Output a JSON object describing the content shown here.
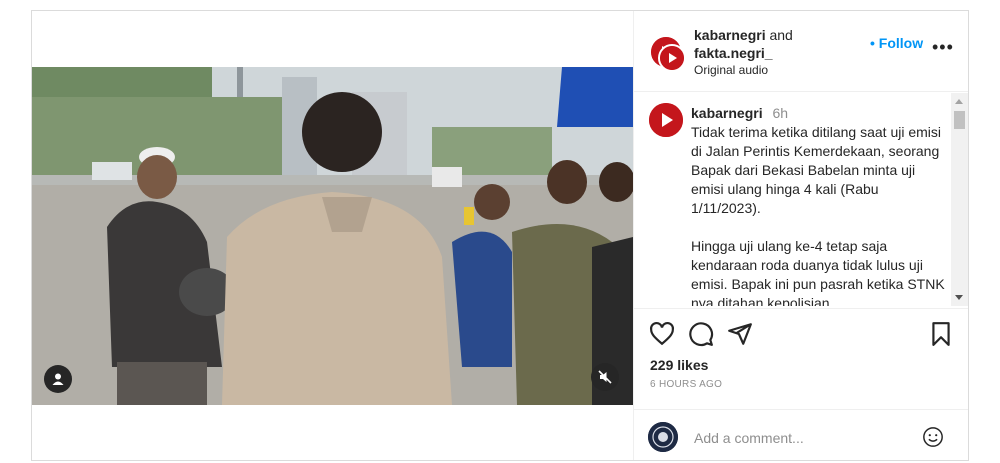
{
  "header": {
    "user1": "kabarnegri",
    "and_text": "and",
    "user2": "fakta.negri_",
    "audio": "Original audio",
    "follow_label": "Follow",
    "more_label": "•••"
  },
  "caption": {
    "username": "kabarnegri",
    "time": "6h",
    "paragraph1": "Tidak terima ketika ditilang saat uji emisi di Jalan Perintis Kemerdekaan, seorang Bapak dari Bekasi Babelan minta uji emisi ulang hinga 4 kali (Rabu 1/11/2023).",
    "paragraph2": "Hingga uji ulang ke-4 tetap saja kendaraan roda duanya tidak lulus uji emisi. Bapak ini pun pasrah ketika STNK nya ditahan kepolisian."
  },
  "engagement": {
    "likes": "229 likes",
    "posted": "6 HOURS AGO"
  },
  "comment": {
    "placeholder": "Add a comment..."
  },
  "icons": [
    "heart-icon",
    "comment-icon",
    "share-icon",
    "bookmark-icon",
    "user-tag-icon",
    "muted-speaker-icon",
    "emoji-icon"
  ],
  "colors": {
    "follow": "#0095f6",
    "brand_red": "#c4161c"
  }
}
